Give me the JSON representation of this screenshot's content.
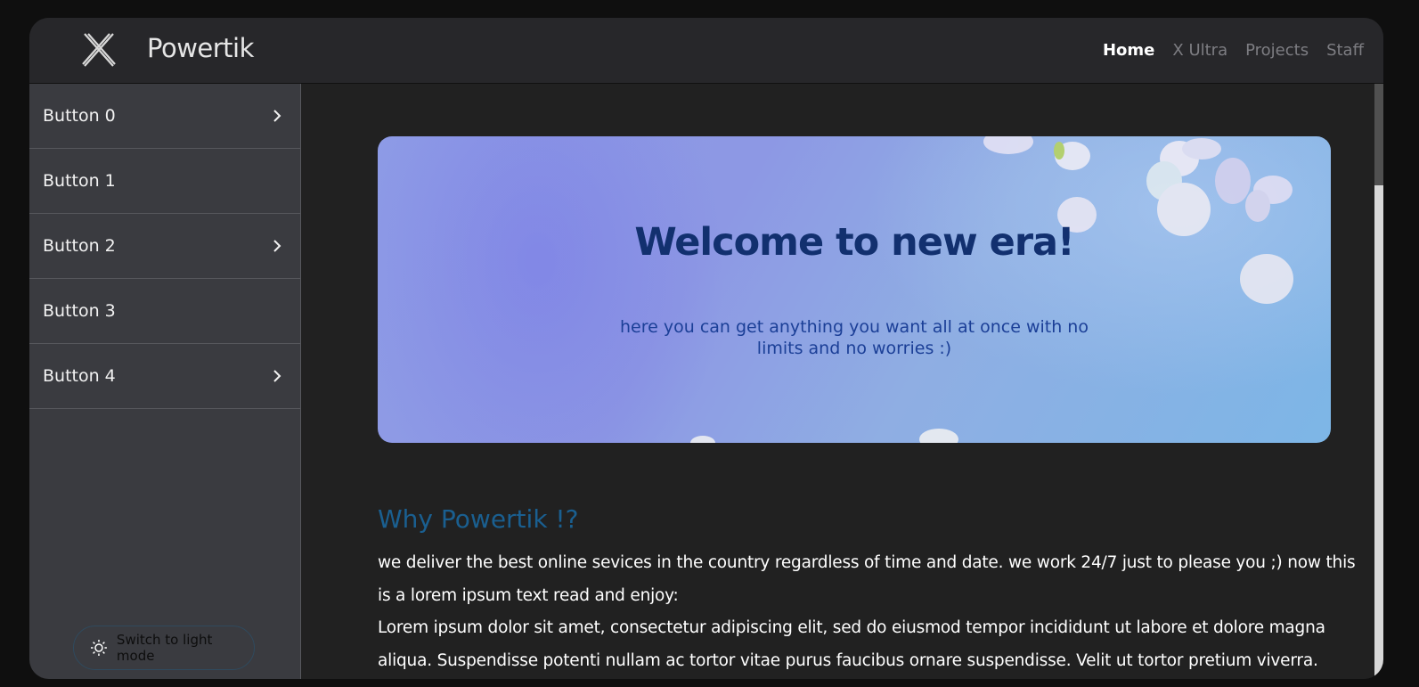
{
  "app": {
    "brand": "Powertik",
    "logo_icon": "x-logo-icon"
  },
  "nav": {
    "items": [
      {
        "label": "Home",
        "active": true
      },
      {
        "label": "X Ultra",
        "active": false
      },
      {
        "label": "Projects",
        "active": false
      },
      {
        "label": "Staff",
        "active": false
      }
    ]
  },
  "sidebar": {
    "items": [
      {
        "label": "Button 0",
        "has_chevron": true
      },
      {
        "label": "Button 1",
        "has_chevron": false
      },
      {
        "label": "Button 2",
        "has_chevron": true
      },
      {
        "label": "Button 3",
        "has_chevron": false
      },
      {
        "label": "Button 4",
        "has_chevron": true
      }
    ],
    "mode_button": {
      "label": "Switch to light mode",
      "icon": "sun-icon"
    }
  },
  "hero": {
    "title": "Welcome to new era!",
    "subtitle": "here you can get anything you want all at once with no limits and no worries :)"
  },
  "section": {
    "title": "Why Powertik !?",
    "paragraph1": "we deliver the best online sevices in the country regardless of time and date. we work 24/7 just to please you ;) now this is a lorem ipsum text read and enjoy:",
    "paragraph2": "Lorem ipsum dolor sit amet, consectetur adipiscing elit, sed do eiusmod tempor incididunt ut labore et dolore magna aliqua. Suspendisse potenti nullam ac tortor vitae purus faucibus ornare suspendisse. Velit ut tortor pretium viverra. Quam quisque id diam"
  },
  "colors": {
    "accent": "#1a5f90",
    "hero_title": "#12306f",
    "hero_subtitle": "#1b3f97"
  }
}
